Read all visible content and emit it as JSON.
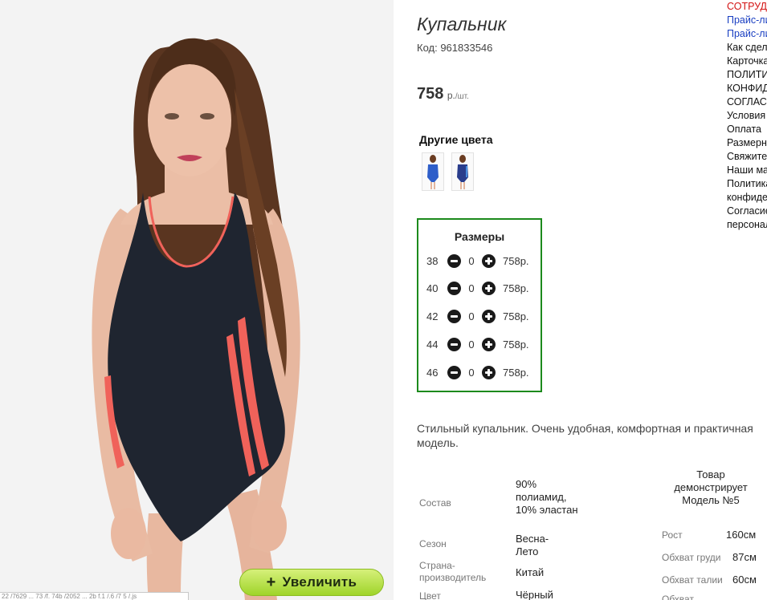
{
  "product": {
    "title": "Купальник",
    "code": "Код: 961833546",
    "price_value": "758",
    "price_unit": "р.",
    "price_per": "/шт."
  },
  "zoom": {
    "plus": "+",
    "label": "Увеличить"
  },
  "status_strip": "22 /7629 ... 73 /f. 74b /2052 ... 2b f.1 /.6 /7 5 /.js",
  "other_colors": {
    "title": "Другие цвета",
    "swatches": [
      {
        "color": "#2e5ec9"
      },
      {
        "color": "#2a3d8c"
      }
    ]
  },
  "sizes": {
    "title": "Размеры",
    "rows": [
      {
        "size": "38",
        "qty": "0",
        "price": "758р."
      },
      {
        "size": "40",
        "qty": "0",
        "price": "758р."
      },
      {
        "size": "42",
        "qty": "0",
        "price": "758р."
      },
      {
        "size": "44",
        "qty": "0",
        "price": "758р."
      },
      {
        "size": "46",
        "qty": "0",
        "price": "758р."
      }
    ]
  },
  "description": "Стильный купальник. Очень удобная, комфортная и практичная модель.",
  "specs": {
    "composition_label": "Состав",
    "composition_value": "90% полиамид, 10% эластан",
    "season_label": "Сезон",
    "season_value": "Весна-Лето",
    "country_label": "Страна-производитель",
    "country_value": "Китай",
    "color_label": "Цвет",
    "color_value": "Чёрный"
  },
  "model": {
    "heading": "Товар демонстрирует Модель №5",
    "height_label": "Рост",
    "height_value": "160см",
    "chest_label": "Обхват груди",
    "chest_value": "87см",
    "waist_label": "Обхват талии",
    "waist_value": "60см",
    "hips_label": "Обхват"
  },
  "menu": [
    {
      "label": "СОТРУДНИЧЕСТВО",
      "style": "red"
    },
    {
      "label": "Прайс-лист",
      "style": "blue"
    },
    {
      "label": "Прайс-лист",
      "style": "blue"
    },
    {
      "label": "Как сделать заказ",
      "style": "plain"
    },
    {
      "label": "Карточка",
      "style": "plain"
    },
    {
      "label": "ПОЛИТИКА",
      "style": "plain"
    },
    {
      "label": "КОНФИДЕНЦИАЛЬНОСТИ",
      "style": "plain"
    },
    {
      "label": "СОГЛАСИЕ",
      "style": "plain"
    },
    {
      "label": "Условия",
      "style": "plain"
    },
    {
      "label": "Оплата",
      "style": "plain"
    },
    {
      "label": "Размерная сетка",
      "style": "plain"
    },
    {
      "label": "Свяжитесь с нами",
      "style": "plain"
    },
    {
      "label": "Наши магазины",
      "style": "plain"
    },
    {
      "label": "Политика",
      "style": "plain"
    },
    {
      "label": "конфиденциальности",
      "style": "plain"
    },
    {
      "label": "Согласие",
      "style": "plain"
    },
    {
      "label": "персональных",
      "style": "plain"
    }
  ]
}
